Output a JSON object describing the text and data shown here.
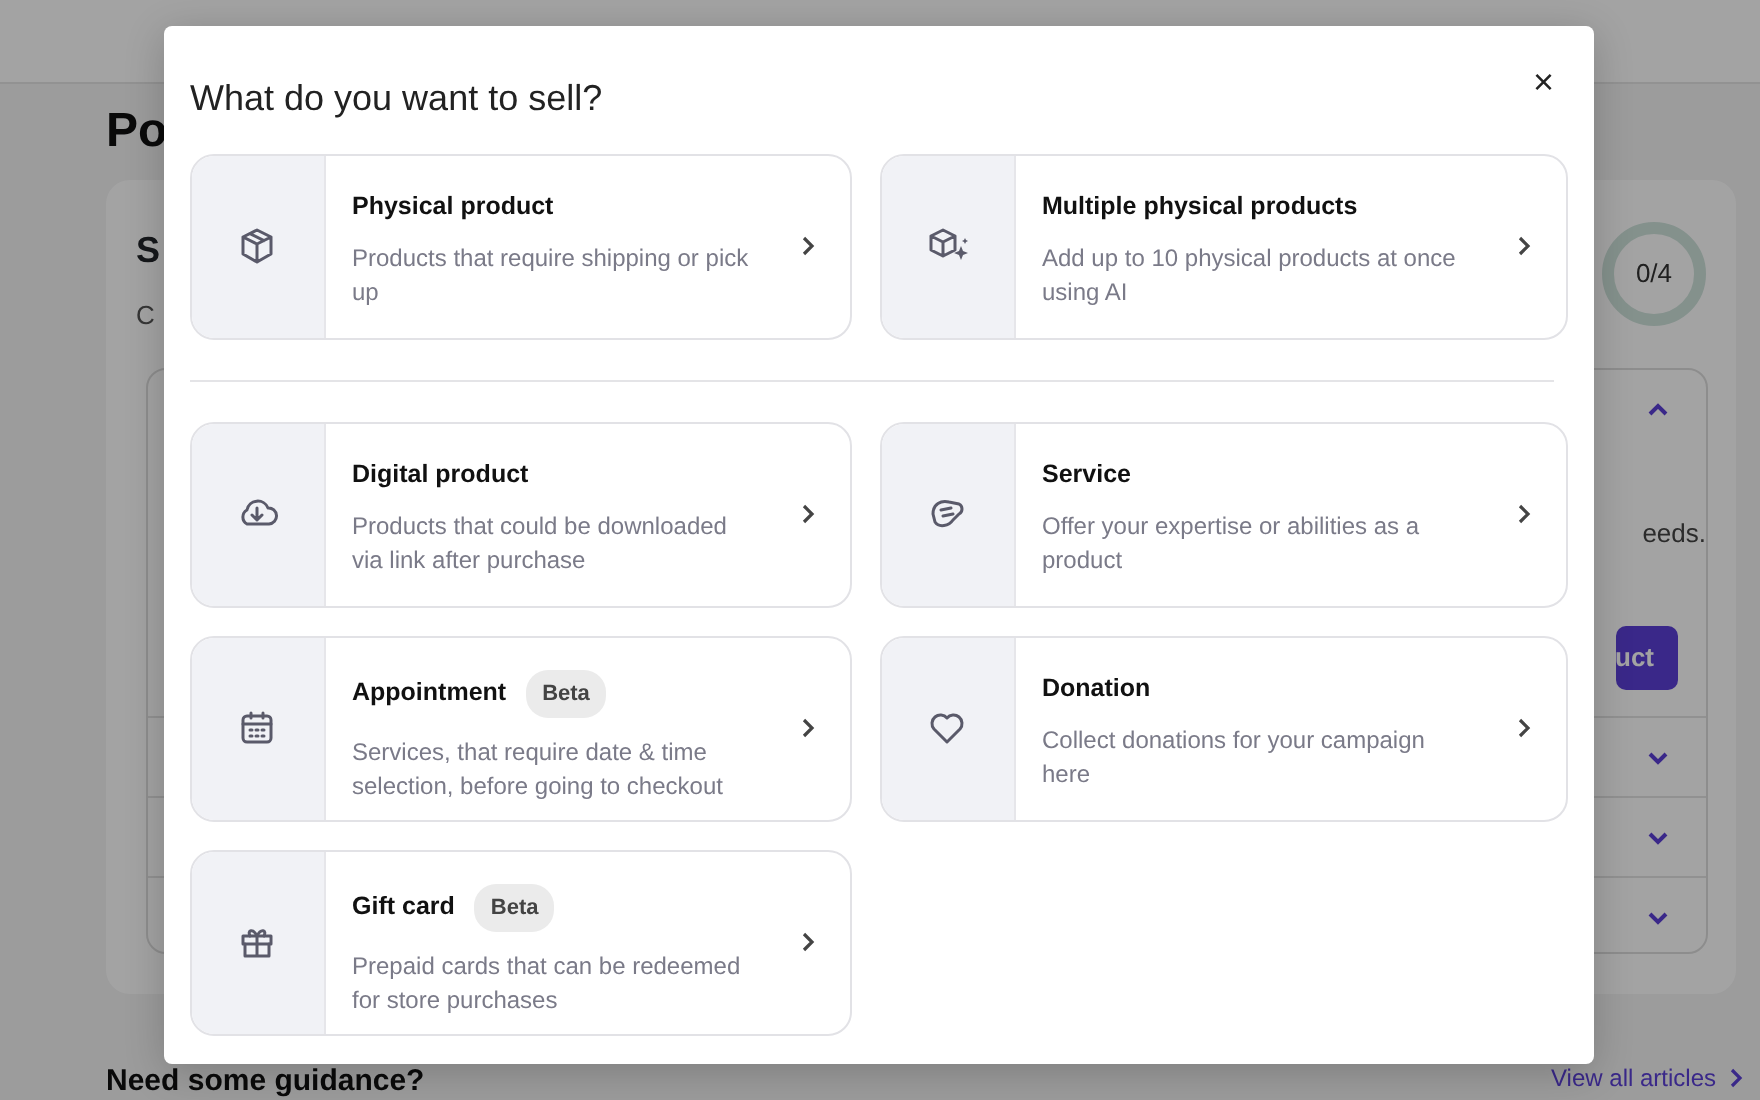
{
  "background": {
    "heading": "Po",
    "card_title": "S",
    "card_subtitle": "C",
    "progress": "0/4",
    "sections": [
      {
        "expanded": true,
        "text": "eeds.",
        "button": "uct"
      },
      {
        "expanded": false
      },
      {
        "expanded": false
      },
      {
        "expanded": false
      }
    ],
    "guidance_title": "Need some guidance?",
    "articles_link": "View all articles"
  },
  "modal": {
    "title": "What do you want to sell?",
    "close": "×",
    "groups": [
      {
        "options": [
          {
            "kind": "physical",
            "title": "Physical product",
            "description": "Products that require shipping or pick up"
          },
          {
            "kind": "multiple",
            "title": "Multiple physical products",
            "description": "Add up to 10 physical products at once using AI"
          }
        ]
      },
      {
        "options": [
          {
            "kind": "digital",
            "title": "Digital product",
            "description": "Products that could be downloaded via link after purchase"
          },
          {
            "kind": "service",
            "title": "Service",
            "description": "Offer your expertise or abilities as a product"
          },
          {
            "kind": "appointment",
            "title": "Appointment",
            "badge": "Beta",
            "description": "Services, that require date & time selection, before going to checkout"
          },
          {
            "kind": "donation",
            "title": "Donation",
            "description": "Collect donations for your campaign here"
          },
          {
            "kind": "gift",
            "title": "Gift card",
            "badge": "Beta",
            "description": "Prepaid cards that can be redeemed for store purchases"
          }
        ]
      }
    ]
  }
}
